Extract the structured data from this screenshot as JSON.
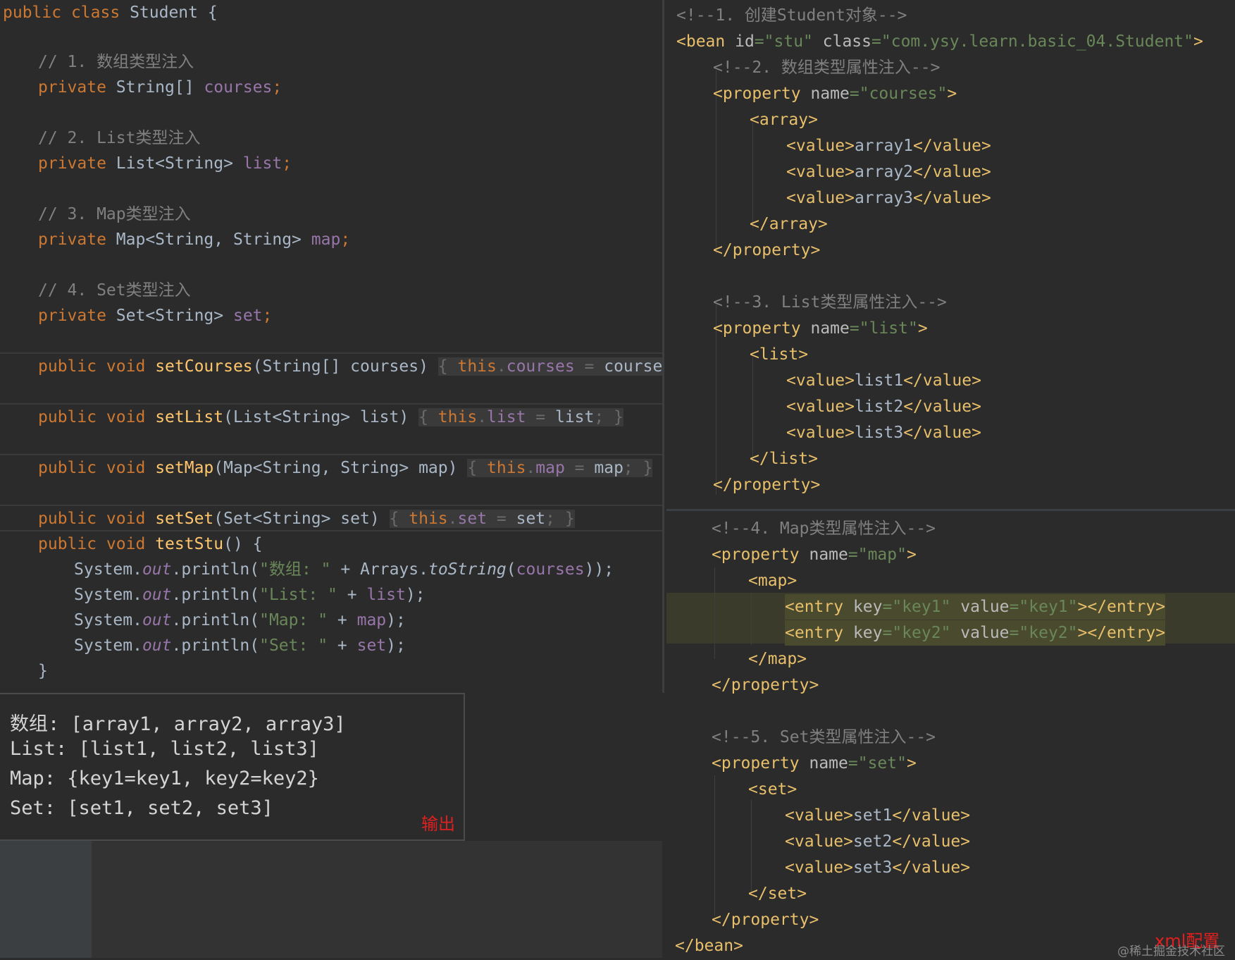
{
  "java": {
    "class_decl": {
      "kw1": "public",
      "kw2": "class",
      "name": "Student",
      "brace": "{"
    },
    "fields": [
      {
        "comment": "// 1. 数组类型注入",
        "type": "String[]",
        "name": "courses"
      },
      {
        "comment": "// 2. List类型注入",
        "type": "List<String>",
        "name": "list"
      },
      {
        "comment": "// 3. Map类型注入",
        "type": "Map<String, String>",
        "name": "map"
      },
      {
        "comment": "// 4. Set类型注入",
        "type": "Set<String>",
        "name": "set"
      }
    ],
    "private_kw": "private",
    "setters": [
      {
        "name": "setCourses",
        "params": "(String[] courses)",
        "field": "courses",
        "arg": "courses"
      },
      {
        "name": "setList",
        "params": "(List<String> list)",
        "field": "list",
        "arg": "list"
      },
      {
        "name": "setMap",
        "params": "(Map<String, String> map)",
        "field": "map",
        "arg": "map"
      },
      {
        "name": "setSet",
        "params": "(Set<String> set)",
        "field": "set",
        "arg": "set"
      }
    ],
    "public_void": "public void",
    "this_kw": "this",
    "test_method": "testStu",
    "prints": [
      {
        "label": "\"数组: \"",
        "expr_pre": " + Arrays.",
        "expr_call": "toString",
        "expr_arg": "courses",
        "expr_post": "));"
      },
      {
        "label": "\"List: \"",
        "expr_pre": " + ",
        "expr_field": "list",
        "expr_post": ");"
      },
      {
        "label": "\"Map: \"",
        "expr_pre": " + ",
        "expr_field": "map",
        "expr_post": ");"
      },
      {
        "label": "\"Set: \"",
        "expr_pre": " + ",
        "expr_field": "set",
        "expr_post": ");"
      }
    ],
    "system": "System.",
    "out": "out",
    ".println(": ".println("
  },
  "output": {
    "lines": [
      "数组: [array1, array2, array3]",
      "List: [list1, list2, list3]",
      "Map: {key1=key1, key2=key2}",
      "Set: [set1, set2, set3]"
    ],
    "label": "输出"
  },
  "xml": {
    "c1": "<!--1. 创建Student对象-->",
    "bean_id": "stu",
    "bean_class": "com.ysy.learn.basic_04.Student",
    "c2": "<!--2. 数组类型属性注入-->",
    "p_courses": "courses",
    "array_values": [
      "array1",
      "array2",
      "array3"
    ],
    "c3": "<!--3. List类型属性注入-->",
    "p_list": "list",
    "list_values": [
      "list1",
      "list2",
      "list3"
    ],
    "c4": "<!--4. Map类型属性注入-->",
    "p_map": "map",
    "entries": [
      {
        "key": "key1",
        "value": "key1"
      },
      {
        "key": "key2",
        "value": "key2"
      }
    ],
    "c5": "<!--5. Set类型属性注入-->",
    "p_set": "set",
    "set_values": [
      "set1",
      "set2",
      "set3"
    ],
    "label": "xml配置",
    "watermark": "@稀土掘金技术社区"
  }
}
